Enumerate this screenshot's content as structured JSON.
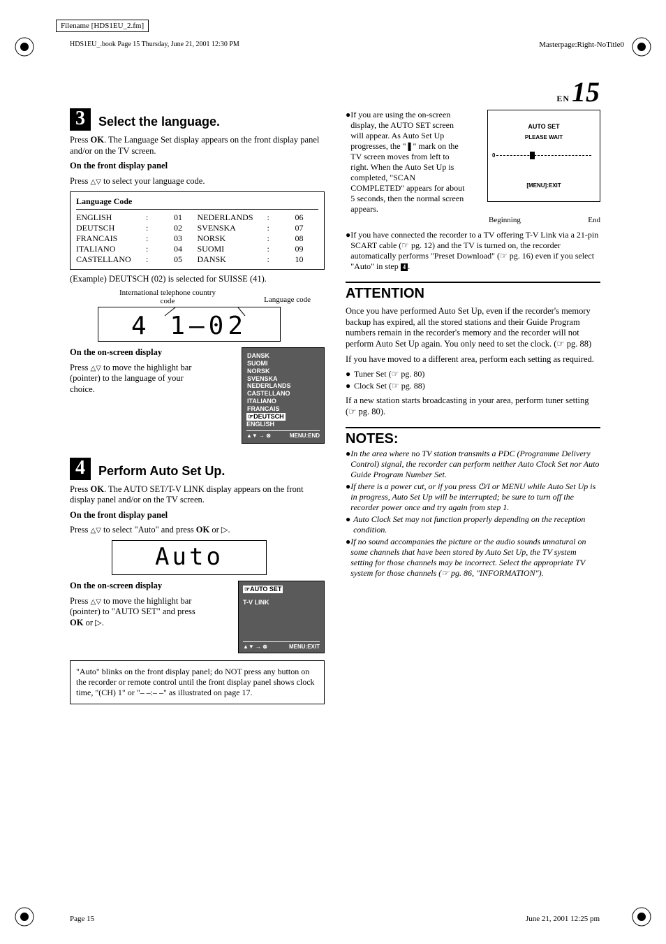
{
  "meta": {
    "filename": "Filename [HDS1EU_2.fm]",
    "bookline": "HDS1EU_.book  Page 15  Thursday, June 21, 2001  12:30 PM",
    "masterpage": "Masterpage:Right-NoTitle0",
    "page_label_prefix": "EN",
    "page_number": "15",
    "footer_left": "Page 15",
    "footer_right": "June 21, 2001  12:25 pm"
  },
  "step3": {
    "num": "3",
    "title": "Select the language.",
    "p1a": "Press ",
    "p1b": "OK",
    "p1c": ". The Language Set display appears on the front display panel and/or on the TV screen.",
    "h1": "On the front display panel",
    "p2a": "Press ",
    "p2b": " to select your language code.",
    "table_header": "Language Code",
    "langs_a": [
      {
        "name": "ENGLISH",
        "code": "01"
      },
      {
        "name": "DEUTSCH",
        "code": "02"
      },
      {
        "name": "FRANCAIS",
        "code": "03"
      },
      {
        "name": "ITALIANO",
        "code": "04"
      },
      {
        "name": "CASTELLANO",
        "code": "05"
      }
    ],
    "langs_b": [
      {
        "name": "NEDERLANDS",
        "code": "06"
      },
      {
        "name": "SVENSKA",
        "code": "07"
      },
      {
        "name": "NORSK",
        "code": "08"
      },
      {
        "name": "SUOMI",
        "code": "09"
      },
      {
        "name": "DANSK",
        "code": "10"
      }
    ],
    "example": "(Example) DEUTSCH (02) is selected for SUISSE (41).",
    "label_intl": "International telephone country code",
    "label_langcode": "Language code",
    "lcd": "4 1 – 0 2",
    "h2": "On the on-screen display",
    "p3a": "Press ",
    "p3b": " to move the highlight bar (pointer) to the language of your choice.",
    "osd_langs": [
      "DANSK",
      "SUOMI",
      "NORSK",
      "SVENSKA",
      "NEDERLANDS",
      "CASTELLANO",
      "ITALIANO",
      "FRANCAIS"
    ],
    "osd_sel": "☞DEUTSCH",
    "osd_last": "ENGLISH",
    "osd_foot_left": "▲▼ → ⊗",
    "osd_foot_right": "MENU:END"
  },
  "step4": {
    "num": "4",
    "title": "Perform Auto Set Up.",
    "p1a": "Press ",
    "p1b": "OK",
    "p1c": ". The AUTO SET/T-V LINK display appears on the front display panel and/or on the TV screen.",
    "h1": "On the front display panel",
    "p2a": "Press ",
    "p2b": " to select \"Auto\" and press ",
    "p2c": "OK",
    "p2d": " or ▷.",
    "lcd": "A u t o",
    "h2": "On the on-screen display",
    "p3a": "Press ",
    "p3b": " to move the highlight bar (pointer) to \"AUTO SET\" and press ",
    "p3c": "OK",
    "p3d": " or ▷.",
    "osd_sel": "☞AUTO SET",
    "osd_item": "T-V LINK",
    "osd_foot_left": "▲▼ → ⊗",
    "osd_foot_right": "MENU:EXIT",
    "note": "\"Auto\" blinks on the front display panel; do NOT press any button on the recorder or remote control until the front display panel shows clock time, \"(CH) 1\" or \"– –:– –\" as illustrated on page 17."
  },
  "right": {
    "b1": "If you are using the on-screen display, the AUTO SET screen will appear. As Auto Set Up progresses, the \"❚\" mark on the TV screen moves from left to right. When the Auto Set Up is completed, \"SCAN COMPLETED\" appears for about 5 seconds, then the normal screen appears.",
    "img_title": "AUTO SET",
    "img_sub": "PLEASE WAIT",
    "img_menu": "[MENU]:EXIT",
    "img_beg": "Beginning",
    "img_end": "End",
    "b2a": "If you have connected the recorder to a TV offering T-V Link via a 21-pin SCART cable (☞ pg. 12) and the TV is turned on, the recorder automatically performs \"Preset Download\" (☞ pg. 16) even if you select \"Auto\" in step ",
    "b2b": ".",
    "step_ref": "4"
  },
  "attention": {
    "title": "ATTENTION",
    "p1": "Once you have performed Auto Set Up, even if the recorder's memory backup has expired, all the stored stations and their Guide Program numbers remain in the recorder's memory and the recorder will not perform Auto Set Up again. You only need to set the clock. (☞ pg. 88)",
    "p2": "If you have moved to a different area, perform each setting as required.",
    "li1": "Tuner Set (☞ pg. 80)",
    "li2": "Clock Set (☞ pg. 88)",
    "p3": "If a new station starts broadcasting in your area, perform tuner setting (☞ pg. 80)."
  },
  "notes": {
    "title": "NOTES:",
    "items": [
      "In the area where no TV station transmits a PDC (Programme Delivery Control) signal, the recorder can perform neither Auto Clock Set nor Auto Guide Program Number Set.",
      "If there is a power cut, or if you press ⏻/I or MENU while Auto Set Up is in progress, Auto Set Up will be interrupted; be sure to turn off the recorder power once and try again from step 1.",
      "Auto Clock Set may not function properly depending on the reception condition.",
      "If no sound accompanies the picture or the audio sounds unnatural on some channels that have been stored by Auto Set Up, the TV system setting for those channels may be incorrect. Select the appropriate TV system for those channels (☞ pg. 86, \"INFORMATION\")."
    ]
  }
}
